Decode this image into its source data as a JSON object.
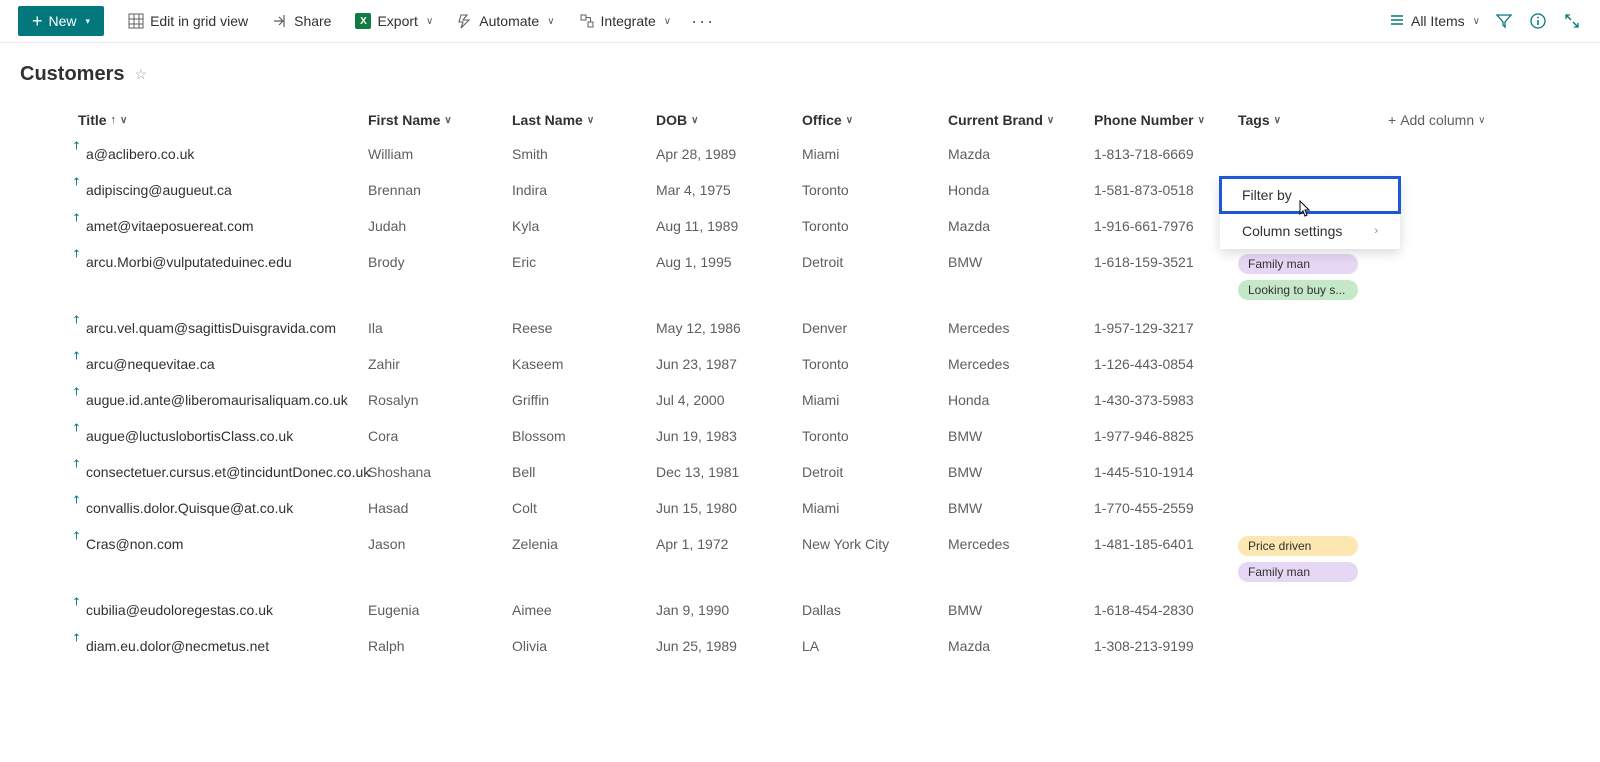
{
  "toolbar": {
    "new_label": "New",
    "edit_grid_label": "Edit in grid view",
    "share_label": "Share",
    "export_label": "Export",
    "automate_label": "Automate",
    "integrate_label": "Integrate",
    "view_label": "All Items"
  },
  "list": {
    "title": "Customers"
  },
  "columns": {
    "title": "Title",
    "first_name": "First Name",
    "last_name": "Last Name",
    "dob": "DOB",
    "office": "Office",
    "current_brand": "Current Brand",
    "phone_number": "Phone Number",
    "tags": "Tags",
    "add_column": "Add column"
  },
  "dropdown": {
    "filter_by": "Filter by",
    "column_settings": "Column settings"
  },
  "tag_colors": {
    "Family man": "tag-purple",
    "Looking to buy s...": "tag-green",
    "Price driven": "tag-yellow"
  },
  "rows": [
    {
      "title": "a@aclibero.co.uk",
      "first": "William",
      "last": "Smith",
      "dob": "Apr 28, 1989",
      "office": "Miami",
      "brand": "Mazda",
      "phone": "1-813-718-6669",
      "tags": []
    },
    {
      "title": "adipiscing@augueut.ca",
      "first": "Brennan",
      "last": "Indira",
      "dob": "Mar 4, 1975",
      "office": "Toronto",
      "brand": "Honda",
      "phone": "1-581-873-0518",
      "tags": []
    },
    {
      "title": "amet@vitaeposuereat.com",
      "first": "Judah",
      "last": "Kyla",
      "dob": "Aug 11, 1989",
      "office": "Toronto",
      "brand": "Mazda",
      "phone": "1-916-661-7976",
      "tags": []
    },
    {
      "title": "arcu.Morbi@vulputateduinec.edu",
      "first": "Brody",
      "last": "Eric",
      "dob": "Aug 1, 1995",
      "office": "Detroit",
      "brand": "BMW",
      "phone": "1-618-159-3521",
      "tags": [
        "Family man",
        "Looking to buy s..."
      ]
    },
    {
      "title": "arcu.vel.quam@sagittisDuisgravida.com",
      "first": "Ila",
      "last": "Reese",
      "dob": "May 12, 1986",
      "office": "Denver",
      "brand": "Mercedes",
      "phone": "1-957-129-3217",
      "tags": []
    },
    {
      "title": "arcu@nequevitae.ca",
      "first": "Zahir",
      "last": "Kaseem",
      "dob": "Jun 23, 1987",
      "office": "Toronto",
      "brand": "Mercedes",
      "phone": "1-126-443-0854",
      "tags": []
    },
    {
      "title": "augue.id.ante@liberomaurisaliquam.co.uk",
      "first": "Rosalyn",
      "last": "Griffin",
      "dob": "Jul 4, 2000",
      "office": "Miami",
      "brand": "Honda",
      "phone": "1-430-373-5983",
      "tags": []
    },
    {
      "title": "augue@luctuslobortisClass.co.uk",
      "first": "Cora",
      "last": "Blossom",
      "dob": "Jun 19, 1983",
      "office": "Toronto",
      "brand": "BMW",
      "phone": "1-977-946-8825",
      "tags": []
    },
    {
      "title": "consectetuer.cursus.et@tinciduntDonec.co.uk",
      "first": "Shoshana",
      "last": "Bell",
      "dob": "Dec 13, 1981",
      "office": "Detroit",
      "brand": "BMW",
      "phone": "1-445-510-1914",
      "tags": []
    },
    {
      "title": "convallis.dolor.Quisque@at.co.uk",
      "first": "Hasad",
      "last": "Colt",
      "dob": "Jun 15, 1980",
      "office": "Miami",
      "brand": "BMW",
      "phone": "1-770-455-2559",
      "tags": []
    },
    {
      "title": "Cras@non.com",
      "first": "Jason",
      "last": "Zelenia",
      "dob": "Apr 1, 1972",
      "office": "New York City",
      "brand": "Mercedes",
      "phone": "1-481-185-6401",
      "tags": [
        "Price driven",
        "Family man"
      ]
    },
    {
      "title": "cubilia@eudoloregestas.co.uk",
      "first": "Eugenia",
      "last": "Aimee",
      "dob": "Jan 9, 1990",
      "office": "Dallas",
      "brand": "BMW",
      "phone": "1-618-454-2830",
      "tags": []
    },
    {
      "title": "diam.eu.dolor@necmetus.net",
      "first": "Ralph",
      "last": "Olivia",
      "dob": "Jun 25, 1989",
      "office": "LA",
      "brand": "Mazda",
      "phone": "1-308-213-9199",
      "tags": []
    }
  ]
}
